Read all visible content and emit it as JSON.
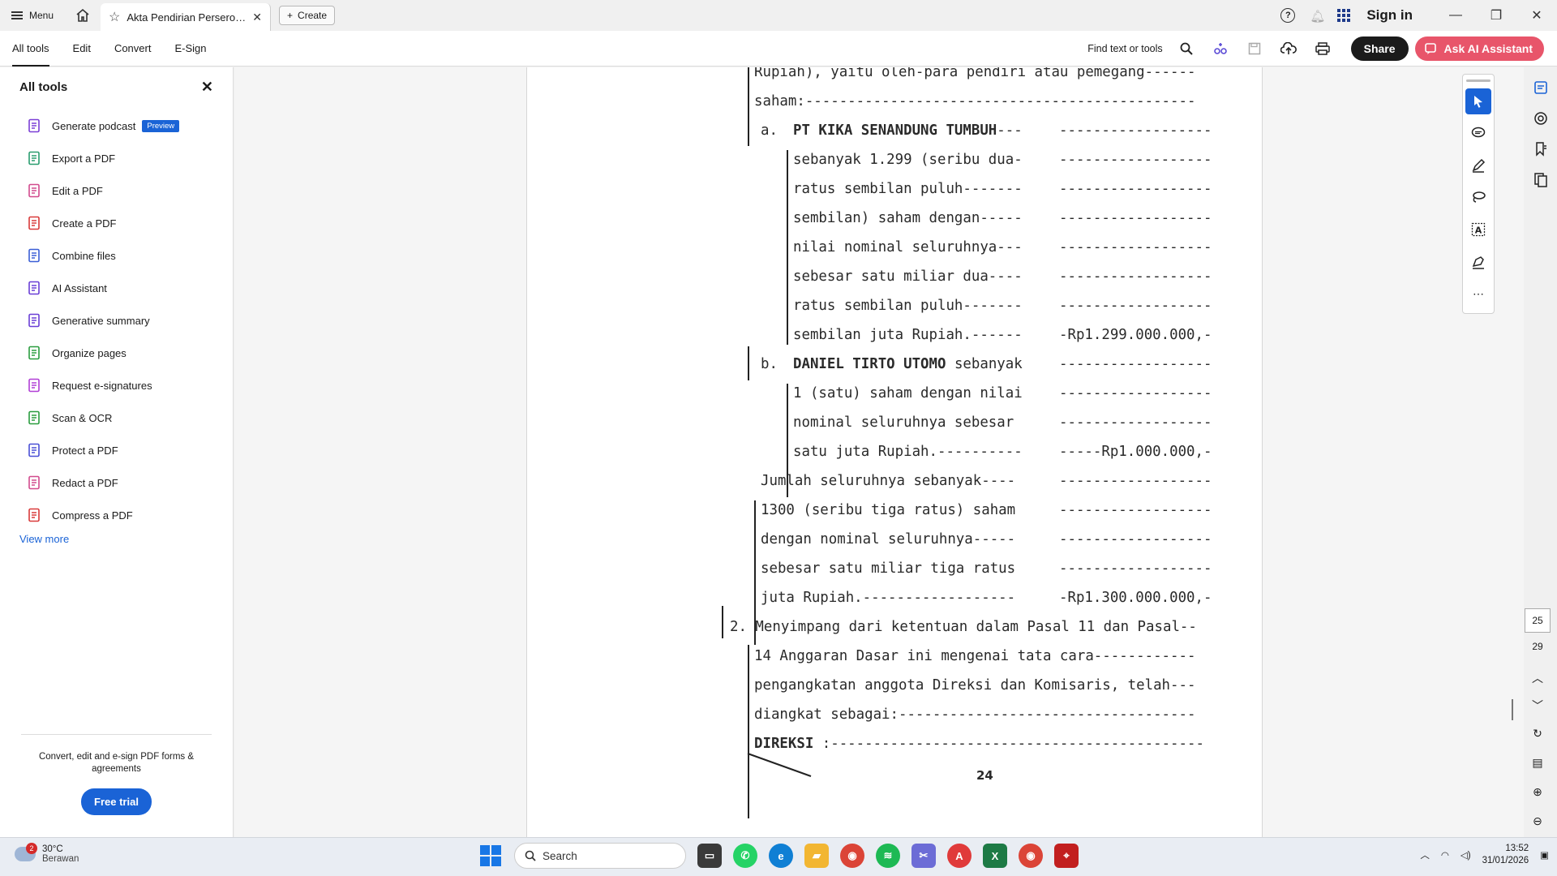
{
  "topbar": {
    "menu_label": "Menu",
    "tab_title": "Akta Pendirian Perseroa...",
    "create_label": "Create",
    "signin_label": "Sign in"
  },
  "toolbar": {
    "tabs": [
      "All tools",
      "Edit",
      "Convert",
      "E-Sign"
    ],
    "find_label": "Find text or tools",
    "share_label": "Share",
    "ai_label": "Ask AI Assistant"
  },
  "sidebar": {
    "title": "All tools",
    "tools": [
      {
        "label": "Generate podcast",
        "icon": "podcast-icon",
        "color": "#7b3fd6"
      },
      {
        "label": "Export a PDF",
        "icon": "export-pdf-icon",
        "color": "#2a9d6f"
      },
      {
        "label": "Edit a PDF",
        "icon": "edit-pdf-icon",
        "color": "#d24b8e"
      },
      {
        "label": "Create a PDF",
        "icon": "create-pdf-icon",
        "color": "#d93a3a"
      },
      {
        "label": "Combine files",
        "icon": "combine-files-icon",
        "color": "#3b5fd6"
      },
      {
        "label": "AI Assistant",
        "icon": "ai-assistant-icon",
        "color": "#6a3fd6"
      },
      {
        "label": "Generative summary",
        "icon": "summary-icon",
        "color": "#6a3fd6"
      },
      {
        "label": "Organize pages",
        "icon": "organize-pages-icon",
        "color": "#2a9d3f"
      },
      {
        "label": "Request e-signatures",
        "icon": "signature-icon",
        "color": "#b13fd6"
      },
      {
        "label": "Scan & OCR",
        "icon": "scan-ocr-icon",
        "color": "#2a9d3f"
      },
      {
        "label": "Protect a PDF",
        "icon": "protect-pdf-icon",
        "color": "#4a50d6"
      },
      {
        "label": "Redact a PDF",
        "icon": "redact-pdf-icon",
        "color": "#d24b8e"
      },
      {
        "label": "Compress a PDF",
        "icon": "compress-pdf-icon",
        "color": "#d93a3a"
      }
    ],
    "preview_badge": "Preview",
    "view_more": "View more",
    "footer_text": "Convert, edit and e-sign PDF forms & agreements",
    "free_trial": "Free trial"
  },
  "document": {
    "lines": [
      "Rupiah), yaitu oleh-para pendiri atau pemegang------",
      "saham:----------------------------------------------",
      "sebanyak 1.299 (seribu dua-",
      "ratus sembilan puluh-------",
      "sembilan) saham dengan-----",
      "nilai nominal seluruhnya---",
      "sebesar satu miliar dua----",
      "ratus sembilan puluh-------",
      "sembilan juta Rupiah.------",
      "1 (satu) saham dengan nilai",
      "nominal seluruhnya sebesar",
      "satu juta Rupiah.----------",
      "Jumlah seluruhnya sebanyak----",
      "1300 (seribu tiga ratus) saham",
      "dengan nominal seluruhnya-----",
      "sebesar satu miliar tiga ratus",
      "juta Rupiah.------------------",
      "2. Menyimpang dari ketentuan dalam Pasal 11 dan Pasal--",
      "14 Anggaran Dasar ini mengenai tata cara------------",
      "pengangkatan anggota Direksi dan Komisaris, telah---",
      "diangkat sebagai:-----------------------------------"
    ],
    "item_a_marker": "a.",
    "item_a_name": "PT KIKA SENANDUNG TUMBUH",
    "item_a_dashes": "---",
    "item_b_marker": "b.",
    "item_b_name": "DANIEL TIRTO UTOMO",
    "item_b_rest": " sebanyak",
    "direksi_label": "DIREKSI",
    "direksi_rest": " :--------------------------------------------",
    "right_col": [
      "------------------",
      "------------------",
      "------------------",
      "------------------",
      "------------------",
      "------------------",
      "------------------",
      "-Rp1.299.000.000,-",
      "------------------",
      "------------------",
      "------------------",
      "-----Rp1.000.000,-",
      "------------------",
      "------------------",
      "------------------",
      "------------------",
      "-Rp1.300.000.000,-"
    ],
    "page_number": "24"
  },
  "page_nav": {
    "current": "25",
    "total": "29"
  },
  "taskbar": {
    "weather_temp": "30°C",
    "weather_desc": "Berawan",
    "weather_badge": "2",
    "search_label": "Search",
    "time": "13:52",
    "date": "31/01/2026"
  }
}
